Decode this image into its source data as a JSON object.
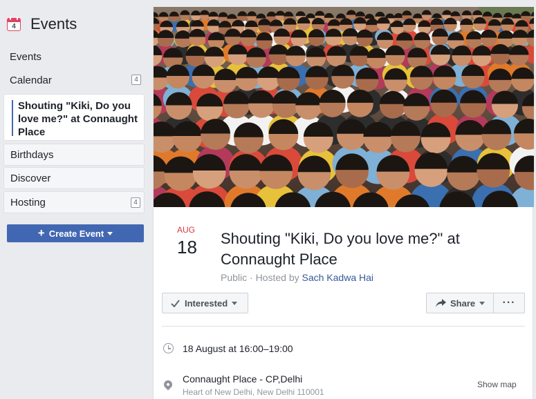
{
  "sidebar": {
    "title": "Events",
    "icon_day": "4",
    "items": [
      {
        "label": "Events"
      },
      {
        "label": "Calendar",
        "badge": "4"
      },
      {
        "label": "Shouting \"Kiki, Do you love me?\" at Connaught Place"
      },
      {
        "label": "Birthdays"
      },
      {
        "label": "Discover"
      },
      {
        "label": "Hosting",
        "badge": "4"
      }
    ],
    "create_button": "Create Event"
  },
  "event": {
    "month": "AUG",
    "day": "18",
    "title": "Shouting \"Kiki, Do you love me?\" at Connaught Place",
    "visibility": "Public · Hosted by ",
    "host": "Sach Kadwa Hai",
    "interested_label": "Interested",
    "share_label": "Share",
    "more_label": "···",
    "time": "18 August at 16:00–19:00",
    "location_name": "Connaught Place - CP,Delhi",
    "location_address": "Heart of New Delhi, New Delhi 110001",
    "show_map": "Show map"
  },
  "colors": {
    "brand_blue": "#4267b2",
    "date_red": "#d9363e",
    "link_blue": "#385898",
    "background": "#e9ebee"
  },
  "icons": [
    "calendar-icon",
    "plus-icon",
    "check-icon",
    "share-arrow-icon",
    "clock-icon",
    "map-pin-icon"
  ]
}
